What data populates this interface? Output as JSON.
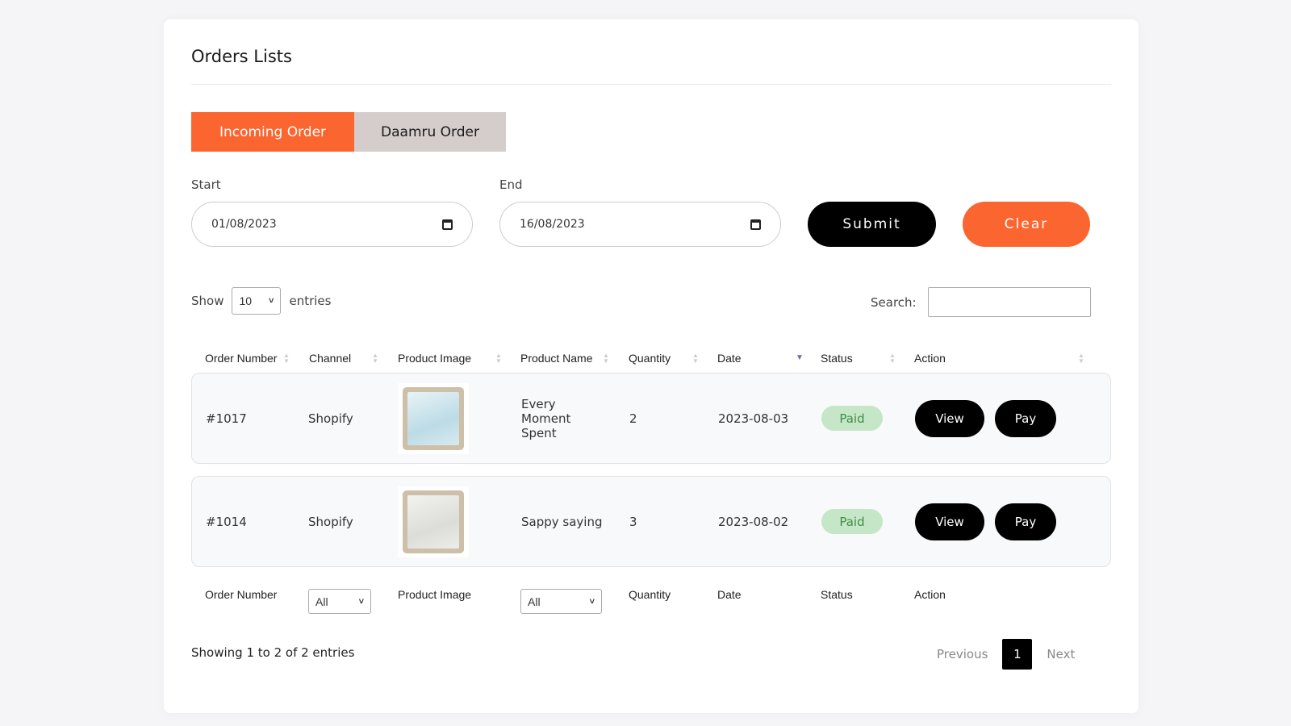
{
  "page": {
    "title": "Orders Lists"
  },
  "tabs": [
    {
      "label": "Incoming Order",
      "active": true
    },
    {
      "label": "Daamru Order",
      "active": false
    }
  ],
  "filters": {
    "start_label": "Start",
    "start_value": "01/08/2023",
    "end_label": "End",
    "end_value": "16/08/2023",
    "submit_label": "Submit",
    "clear_label": "Clear"
  },
  "length": {
    "show_label": "Show",
    "value": "10",
    "entries_label": "entries"
  },
  "search": {
    "label": "Search:",
    "value": ""
  },
  "columns": [
    "Order Number",
    "Channel",
    "Product Image",
    "Product Name",
    "Quantity",
    "Date",
    "Status",
    "Action"
  ],
  "sort": {
    "column": "Date",
    "direction": "desc"
  },
  "rows": [
    {
      "order": "#1017",
      "channel": "Shopify",
      "product_name": "Every Moment Spent",
      "quantity": "2",
      "date": "2023-08-03",
      "status": "Paid",
      "view_label": "View",
      "pay_label": "Pay"
    },
    {
      "order": "#1014",
      "channel": "Shopify",
      "product_name": "Sappy saying",
      "quantity": "3",
      "date": "2023-08-02",
      "status": "Paid",
      "view_label": "View",
      "pay_label": "Pay"
    }
  ],
  "footer": {
    "order_number": "Order Number",
    "channel_filter": "All",
    "product_image": "Product Image",
    "product_name_filter": "All",
    "quantity": "Quantity",
    "date": "Date",
    "status": "Status",
    "action": "Action"
  },
  "info": "Showing 1 to 2 of 2 entries",
  "pagination": {
    "previous": "Previous",
    "current": "1",
    "next": "Next"
  },
  "colors": {
    "accent": "#fb6530",
    "tab_inactive": "#d5cccc",
    "paid_bg": "#c6e6c8",
    "paid_text": "#3e8e45"
  }
}
